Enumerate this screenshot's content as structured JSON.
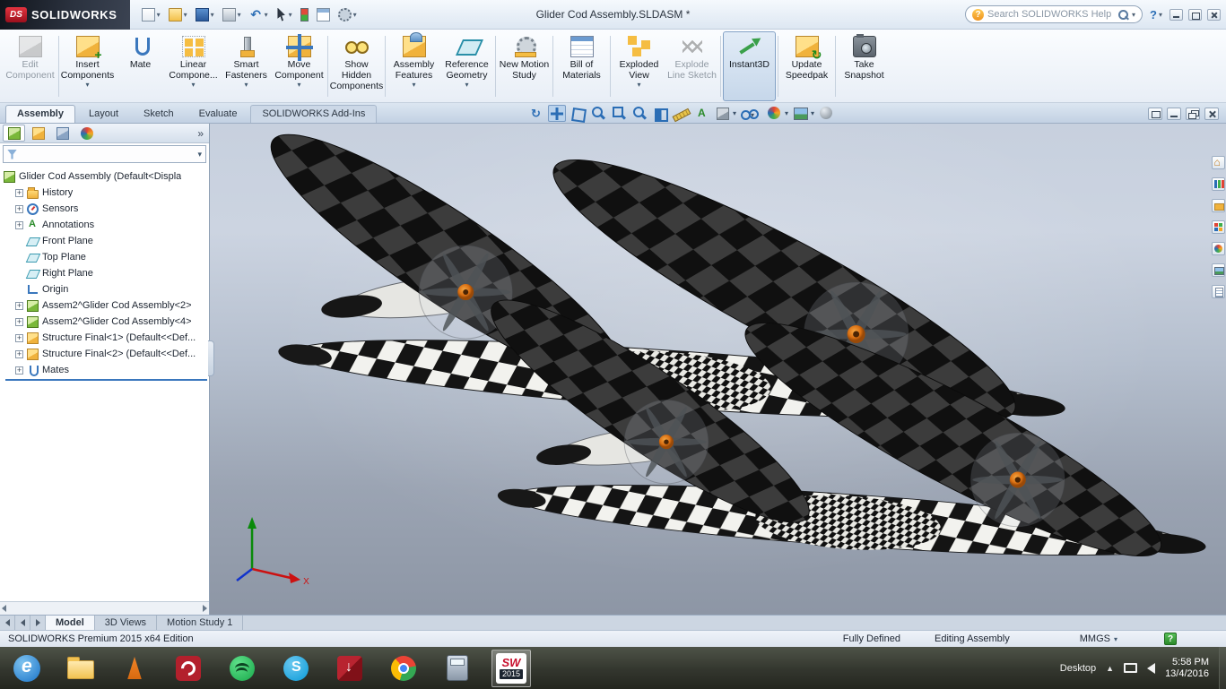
{
  "titlebar": {
    "brand_mark": "DS",
    "brand": "SOLIDWORKS",
    "title": "Glider Cod Assembly.SLDASM *",
    "search_placeholder": "Search SOLIDWORKS Help",
    "help": "?"
  },
  "quick_access_icons": [
    "new-document-icon",
    "open-icon",
    "save-icon",
    "print-icon",
    "undo-icon",
    "select-cursor-icon",
    "rebuild-icon",
    "file-properties-icon",
    "options-gear-icon"
  ],
  "ribbon": {
    "buttons": [
      {
        "label": "Edit Component",
        "state": "disabled",
        "icon": "edit-component-icon"
      },
      {
        "label": "Insert Components",
        "dropdown": true,
        "icon": "insert-components-icon"
      },
      {
        "label": "Mate",
        "icon": "mate-icon"
      },
      {
        "label": "Linear Compone...",
        "dropdown": true,
        "icon": "linear-pattern-icon"
      },
      {
        "label": "Smart Fasteners",
        "dropdown": true,
        "icon": "smart-fasteners-icon"
      },
      {
        "label": "Move Component",
        "dropdown": true,
        "icon": "move-component-icon"
      },
      {
        "label": "Show Hidden Components",
        "icon": "show-hidden-components-icon"
      },
      {
        "label": "Assembly Features",
        "dropdown": true,
        "icon": "assembly-features-icon"
      },
      {
        "label": "Reference Geometry",
        "dropdown": true,
        "icon": "reference-geometry-icon"
      },
      {
        "label": "New Motion Study",
        "icon": "new-motion-study-icon"
      },
      {
        "label": "Bill of Materials",
        "icon": "bill-of-materials-icon"
      },
      {
        "label": "Exploded View",
        "dropdown": true,
        "icon": "exploded-view-icon"
      },
      {
        "label": "Explode Line Sketch",
        "state": "disabled",
        "icon": "explode-line-sketch-icon"
      },
      {
        "label": "Instant3D",
        "state": "active",
        "icon": "instant3d-icon"
      },
      {
        "label": "Update Speedpak",
        "icon": "update-speedpak-icon"
      },
      {
        "label": "Take Snapshot",
        "icon": "take-snapshot-icon"
      }
    ]
  },
  "tabs": [
    "Assembly",
    "Layout",
    "Sketch",
    "Evaluate",
    "SOLIDWORKS Add-Ins"
  ],
  "active_tab": "Assembly",
  "headsup_icons": [
    "refresh-view-icon",
    "pan-icon",
    "view-orientation-icon",
    "zoom-to-fit-icon",
    "zoom-to-area-icon",
    "zoom-in-out-icon",
    "section-view-icon",
    "measure-icon",
    "annotations-view-icon",
    "display-style-icon",
    "hide-show-items-icon",
    "edit-appearance-icon",
    "apply-scene-icon",
    "view-settings-icon",
    "render-options-icon"
  ],
  "doc_controls": [
    "new-window-icon",
    "minimize-doc-icon",
    "restore-doc-icon",
    "close-doc-icon"
  ],
  "feature_panel": {
    "tab_icons": [
      "feature-manager-tab-icon",
      "property-manager-tab-icon",
      "configuration-manager-tab-icon",
      "display-manager-tab-icon"
    ],
    "overflow": "»",
    "tree": [
      {
        "label": "Glider Cod Assembly (Default<Displa",
        "icon": "assembly-icon",
        "level": 0
      },
      {
        "label": "History",
        "icon": "history-folder-icon",
        "level": 1,
        "expandable": true
      },
      {
        "label": "Sensors",
        "icon": "sensors-icon",
        "level": 1,
        "expandable": true
      },
      {
        "label": "Annotations",
        "icon": "annotations-icon",
        "level": 1,
        "expandable": true
      },
      {
        "label": "Front Plane",
        "icon": "plane-icon",
        "level": 1
      },
      {
        "label": "Top Plane",
        "icon": "plane-icon",
        "level": 1
      },
      {
        "label": "Right Plane",
        "icon": "plane-icon",
        "level": 1
      },
      {
        "label": "Origin",
        "icon": "origin-icon",
        "level": 1
      },
      {
        "label": "Assem2^Glider Cod Assembly<2>",
        "icon": "subassembly-icon",
        "level": 1,
        "expandable": true
      },
      {
        "label": "Assem2^Glider Cod Assembly<4>",
        "icon": "subassembly-icon",
        "level": 1,
        "expandable": true
      },
      {
        "label": "Structure Final<1> (Default<<Def...",
        "icon": "part-icon",
        "level": 1,
        "expandable": true
      },
      {
        "label": "Structure Final<2> (Default<<Def...",
        "icon": "part-icon",
        "level": 1,
        "expandable": true
      },
      {
        "label": "Mates",
        "icon": "mates-icon",
        "level": 1,
        "expandable": true
      }
    ]
  },
  "viewport": {
    "triad_x_label": "X",
    "model_colors": {
      "checker_light": "#f2f2ee",
      "checker_dark": "#141414",
      "wing_dark": "#101010",
      "wing_gray": "#3c3c3c",
      "hub_orange": "#e07818"
    }
  },
  "task_pane_icons": [
    "resources-home-icon",
    "design-library-icon",
    "file-explorer-icon",
    "view-palette-icon",
    "appearances-icon",
    "scenes-icon",
    "custom-properties-icon"
  ],
  "bottom_tabs": {
    "items": [
      "Model",
      "3D Views",
      "Motion Study 1"
    ],
    "active": "Model"
  },
  "statusbar": {
    "edition": "SOLIDWORKS Premium 2015 x64 Edition",
    "define_state": "Fully Defined",
    "mode": "Editing Assembly",
    "units": "MMGS",
    "help_badge": "?"
  },
  "taskbar": {
    "app_icons": [
      "internet-explorer-icon",
      "file-explorer-icon",
      "vlc-icon",
      "acrobat-reader-icon",
      "spotify-icon",
      "skype-icon",
      "download-manager-icon",
      "chrome-icon",
      "calculator-icon",
      "solidworks-icon"
    ],
    "solidworks_mark": "SW",
    "solidworks_badge": "2015",
    "tray": {
      "desktop_label": "Desktop",
      "time": "5:58 PM",
      "date": "13/4/2016"
    }
  }
}
